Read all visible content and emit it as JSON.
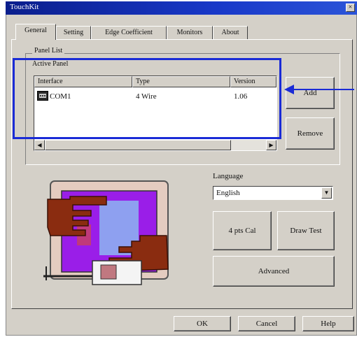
{
  "window": {
    "title": "TouchKit",
    "close_glyph": "×"
  },
  "tabs": [
    {
      "label": "General",
      "active": true
    },
    {
      "label": "Setting"
    },
    {
      "label": "Edge Coefficient"
    },
    {
      "label": "Monitors"
    },
    {
      "label": "About"
    }
  ],
  "panel_list": {
    "group_label": "Panel List",
    "active_label": "Active Panel",
    "columns": [
      "Interface",
      "Type",
      "Version"
    ],
    "rows": [
      {
        "interface": "COM1",
        "type": "4 Wire",
        "version": "1.06"
      }
    ],
    "scroll_left_glyph": "◀",
    "scroll_right_glyph": "▶"
  },
  "buttons": {
    "add": "Add",
    "remove": "Remove",
    "cal_4pts": "4 pts Cal",
    "draw_test": "Draw Test",
    "advanced": "Advanced",
    "ok": "OK",
    "cancel": "Cancel",
    "help": "Help"
  },
  "language": {
    "label": "Language",
    "selected": "English",
    "dropdown_glyph": "▼"
  },
  "annotation": {
    "highlight_color": "#1a2bd6"
  },
  "icons": {
    "device": "serial-port-icon",
    "illustration": "touchscreen-hand-illustration"
  }
}
